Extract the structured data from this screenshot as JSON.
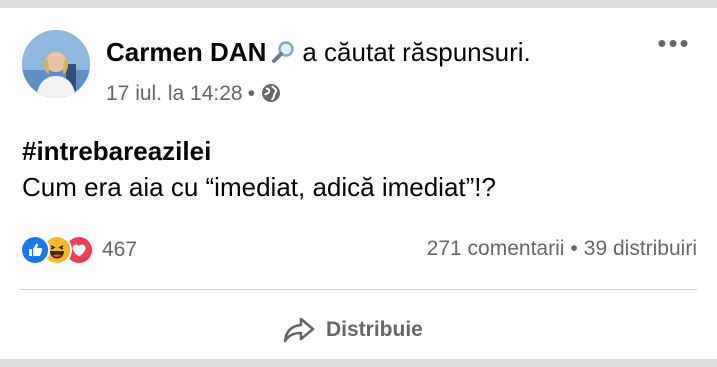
{
  "post": {
    "author": "Carmen DAN",
    "activity_icon": "magnifying-glass-icon",
    "activity": "a căutat răspunsuri.",
    "timestamp": "17 iul. la 14:28",
    "separator": "•",
    "privacy_icon": "globe-icon",
    "more_label": "•••",
    "hashtag": "#intrebareazilei",
    "text": "Cum era aia cu “imediat, adică imediat”!?"
  },
  "footer": {
    "reaction_icons": [
      "like-icon",
      "haha-icon",
      "love-icon"
    ],
    "reaction_colors": {
      "like": "#1877f2",
      "haha": "#f7b928",
      "love": "#f33e58"
    },
    "reaction_count": "467",
    "comments": "271 comentarii",
    "stats_separator": "•",
    "shares": "39 distribuiri",
    "share_label": "Distribuie"
  }
}
